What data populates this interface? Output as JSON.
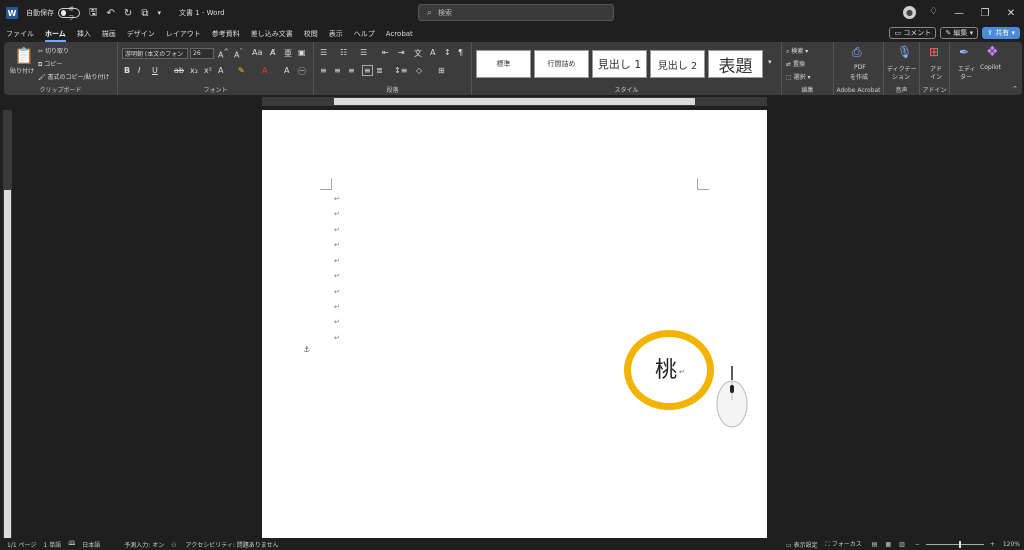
{
  "titlebar": {
    "autosave_label": "自動保存",
    "autosave_state": "オフ",
    "doc_title": "文書 1 - Word",
    "search_placeholder": "検索"
  },
  "menu": {
    "tabs": [
      "ファイル",
      "ホーム",
      "挿入",
      "描画",
      "デザイン",
      "レイアウト",
      "参考資料",
      "差し込み文書",
      "校閲",
      "表示",
      "ヘルプ",
      "Acrobat"
    ],
    "active": "ホーム",
    "comment": "コメント",
    "edit": "編集",
    "share": "共有"
  },
  "ribbon": {
    "clipboard": {
      "paste": "貼り付け",
      "cut": "切り取り",
      "copy": "コピー",
      "format_painter": "書式のコピー/貼り付け",
      "label": "クリップボード"
    },
    "font": {
      "name": "游明朝 (本文のフォン",
      "size": "26",
      "label": "フォント"
    },
    "paragraph": {
      "label": "段落"
    },
    "styles": {
      "items": [
        "標準",
        "行間詰め",
        "見出し 1",
        "見出し 2",
        "表題"
      ],
      "label": "スタイル"
    },
    "editing": {
      "find": "検索",
      "replace": "置換",
      "select": "選択",
      "label": "編集"
    },
    "acrobat": {
      "pdf": "PDF",
      "create": "を作成",
      "label": "Adobe Acrobat"
    },
    "voice": {
      "dictate": "ディクテー",
      "dictate2": "ション",
      "label": "音声"
    },
    "addins": {
      "addin": "アド",
      "addin2": "イン",
      "label": "アドイン"
    },
    "editor": {
      "editor": "エディ",
      "editor2": "ター"
    },
    "copilot": {
      "label": "Copilot"
    }
  },
  "document": {
    "peach_char": "桃",
    "para_mark": "↵"
  },
  "statusbar": {
    "page": "1/1 ページ",
    "words": "1 単語",
    "language": "日本語",
    "ime": "予測入力: オン",
    "accessibility": "アクセシビリティ: 問題ありません",
    "display_settings": "表示設定",
    "focus": "フォーカス",
    "zoom": "120%"
  }
}
